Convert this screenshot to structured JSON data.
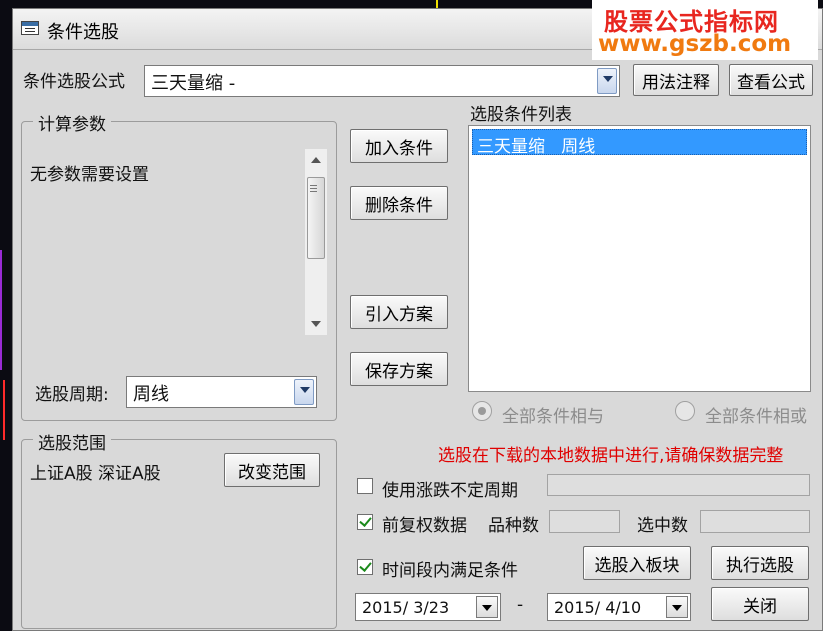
{
  "window": {
    "title": "条件选股"
  },
  "watermark": {
    "line1": "股票公式指标网",
    "line2": "www.gszb.com",
    "color1": "#e8261f",
    "color2": "#f07a10"
  },
  "formula": {
    "label": "条件选股公式",
    "selected": "三天量缩 -",
    "usage_button": "用法注释",
    "view_button": "查看公式"
  },
  "params": {
    "group_title": "计算参数",
    "message": "无参数需要设置",
    "period_label": "选股周期:",
    "period_value": "周线"
  },
  "actions": {
    "add": "加入条件",
    "delete": "删除条件",
    "import": "引入方案",
    "save": "保存方案"
  },
  "conditions": {
    "title": "选股条件列表",
    "items": [
      "三天量缩   周线"
    ],
    "and_label": "全部条件相与",
    "or_label": "全部条件相或",
    "selection": "and"
  },
  "range": {
    "group_title": "选股范围",
    "value": "上证A股 深证A股",
    "change_button": "改变范围"
  },
  "notice": {
    "text": "选股在下载的本地数据中进行,请确保数据完整",
    "color": "#e00000"
  },
  "options": {
    "uncertain_period": {
      "label": "使用涨跌不定周期",
      "checked": false,
      "value": ""
    },
    "pre_adjust": {
      "label": "前复权数据",
      "checked": true
    },
    "variety_count_label": "品种数",
    "variety_count": "",
    "selected_count_label": "选中数",
    "selected_count": "",
    "time_range": {
      "label": "时间段内满足条件",
      "checked": true
    }
  },
  "dates": {
    "start": "2015/ 3/23",
    "separator": "-",
    "end": "2015/ 4/10"
  },
  "bottom_buttons": {
    "to_block": "选股入板块",
    "execute": "执行选股",
    "close": "关闭"
  }
}
